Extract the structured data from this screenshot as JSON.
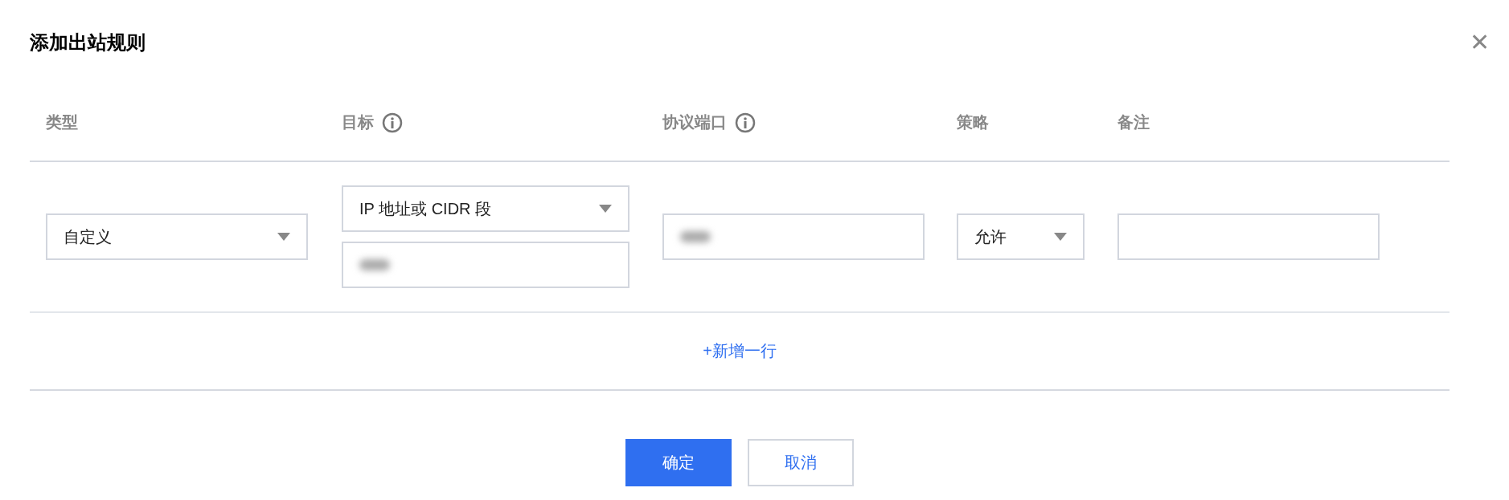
{
  "dialog": {
    "title": "添加出站规则",
    "close": "✕"
  },
  "columns": [
    {
      "label": "类型",
      "info": false
    },
    {
      "label": "目标",
      "info": true
    },
    {
      "label": "协议端口",
      "info": true
    },
    {
      "label": "策略",
      "info": false
    },
    {
      "label": "备注",
      "info": false
    }
  ],
  "row": {
    "type": {
      "value": "自定义"
    },
    "target": {
      "value": "IP 地址或 CIDR 段",
      "redacted": true
    },
    "port": {
      "redacted": true
    },
    "policy": {
      "value": "允许"
    },
    "remark": {
      "redacted": false
    }
  },
  "add_row": "+新增一行",
  "buttons": [
    {
      "label": "确定",
      "kind": "primary"
    },
    {
      "label": "取消",
      "kind": "secondary"
    }
  ]
}
